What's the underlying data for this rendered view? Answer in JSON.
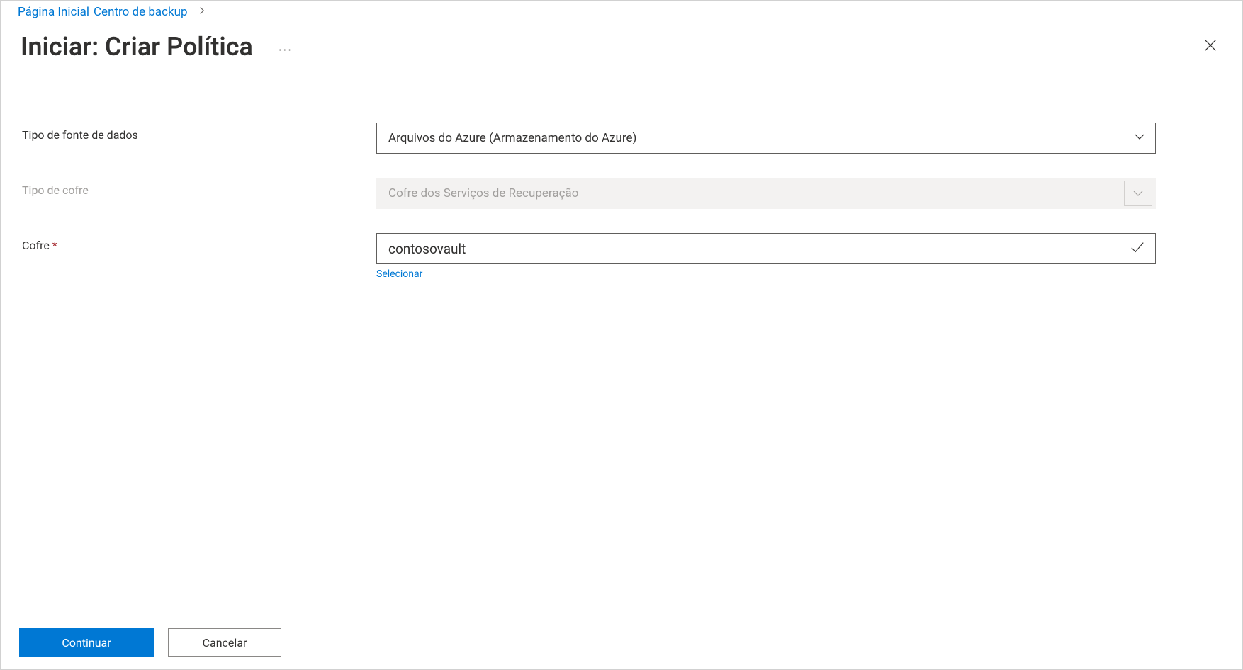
{
  "breadcrumb": {
    "home": "Página Inicial",
    "backup_center": "Centro de backup"
  },
  "header": {
    "title": "Iniciar: Criar Política"
  },
  "form": {
    "datasource_type": {
      "label": "Tipo de fonte de dados",
      "value": "Arquivos do Azure (Armazenamento do Azure)"
    },
    "vault_type": {
      "label": "Tipo de cofre",
      "value": "Cofre dos Serviços de Recuperação"
    },
    "vault": {
      "label": "Cofre",
      "value": "contosovault",
      "select_link": "Selecionar"
    }
  },
  "footer": {
    "continue": "Continuar",
    "cancel": "Cancelar"
  }
}
